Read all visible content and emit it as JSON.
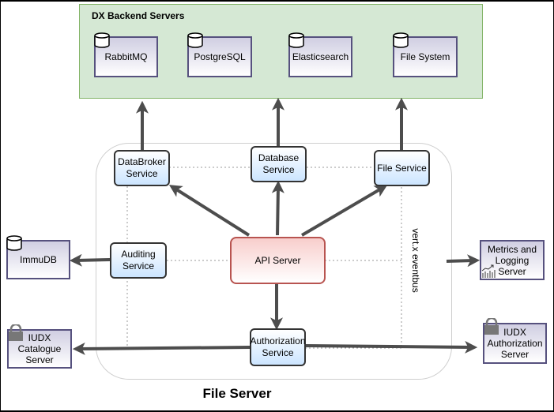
{
  "diagram": {
    "title": "File Server",
    "backend_group": {
      "title": "DX Backend Servers",
      "servers": [
        {
          "label": "RabbitMQ",
          "icon": "database-cylinder-icon"
        },
        {
          "label": "PostgreSQL",
          "icon": "database-cylinder-icon"
        },
        {
          "label": "Elasticsearch",
          "icon": "database-cylinder-icon"
        },
        {
          "label": "File System",
          "icon": "database-cylinder-icon"
        }
      ]
    },
    "services": {
      "databroker": "DataBroker Service",
      "database": "Database Service",
      "file": "File Service",
      "auditing": "Auditing Service",
      "authorization": "Authorization Service"
    },
    "api_server": "API Server",
    "eventbus_label": "vert.x eventbus",
    "external": {
      "immudb": {
        "label": "ImmuDB",
        "icon": "database-cylinder-icon"
      },
      "metrics": {
        "label": "Metrics and Logging Server",
        "icon": "chart-trend-icon"
      },
      "catalogue": {
        "label": "IUDX Catalogue Server",
        "icon": "lock-icon"
      },
      "auth_server": {
        "label": "IUDX Authorization Server",
        "icon": "lock-icon"
      }
    },
    "colors": {
      "backend_fill": "#d5e8d4",
      "backend_border": "#82b366",
      "db_border": "#56517e",
      "service_fill": "#cce5ff",
      "api_fill": "#f8cecc",
      "api_border": "#b85450",
      "arrow": "#4d4d4d"
    }
  }
}
